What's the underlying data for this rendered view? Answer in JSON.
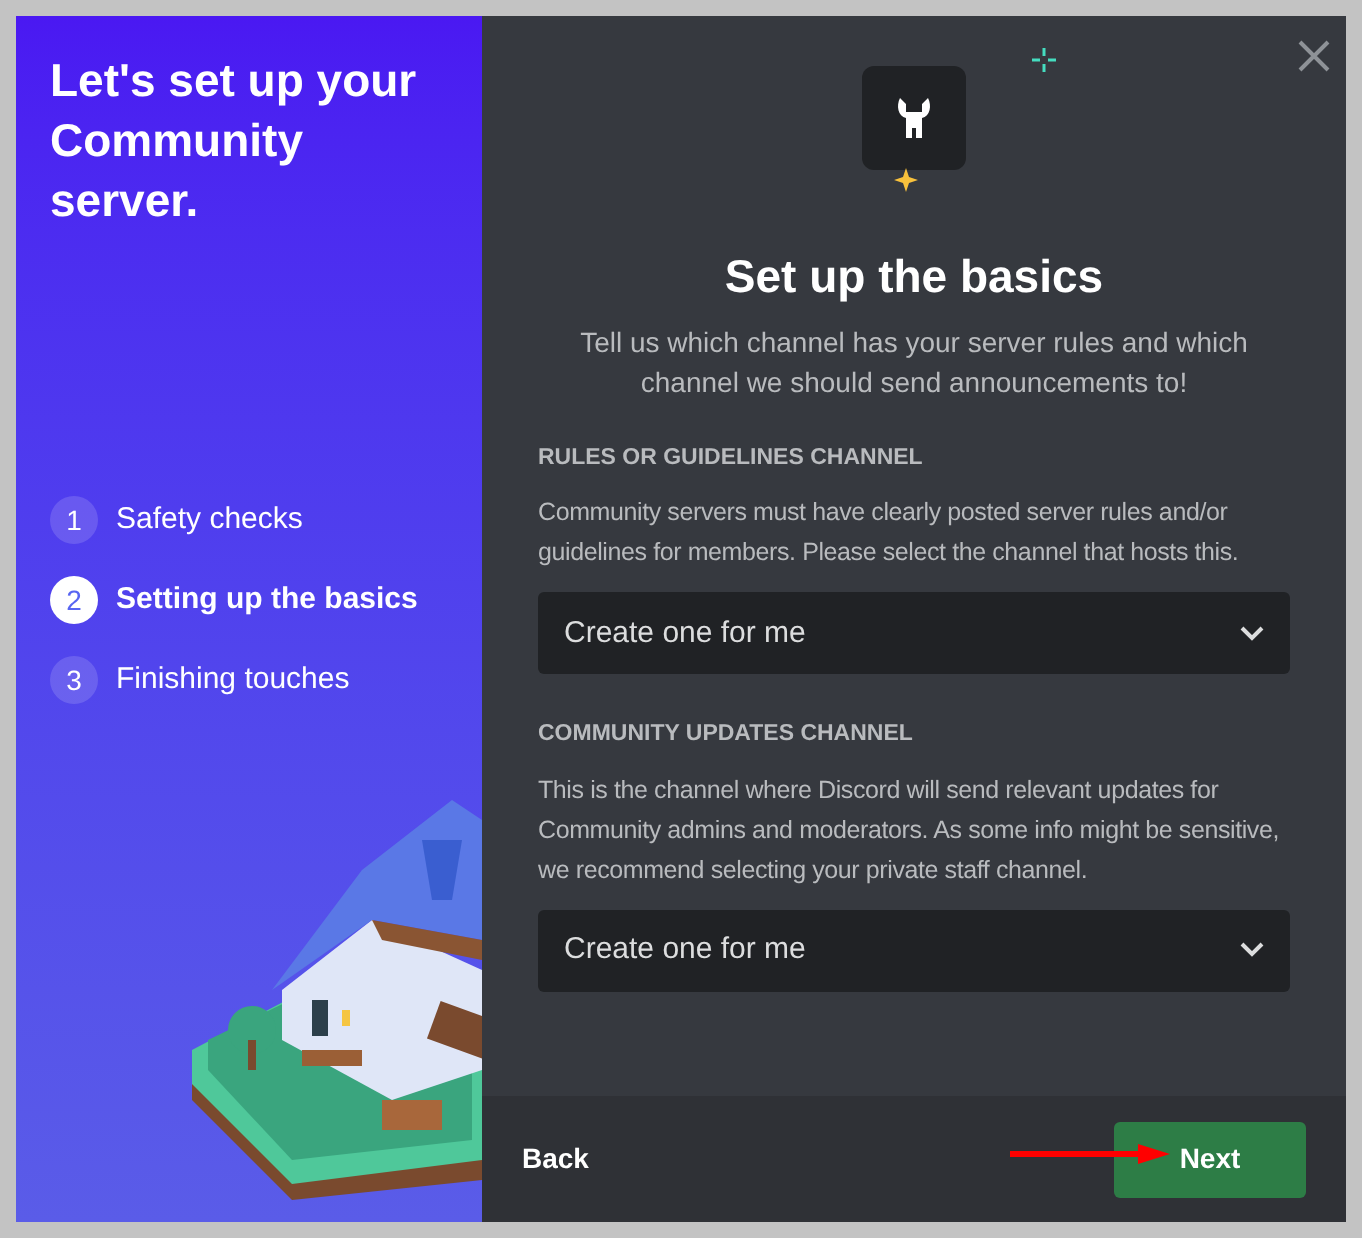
{
  "sidebar": {
    "title": "Let's set up your Community server.",
    "steps": [
      {
        "number": "1",
        "label": "Safety checks",
        "selected": false
      },
      {
        "number": "2",
        "label": "Setting up the basics",
        "selected": true
      },
      {
        "number": "3",
        "label": "Finishing touches",
        "selected": false
      }
    ]
  },
  "main": {
    "title": "Set up the basics",
    "subtitle": "Tell us which channel has your server rules and which channel we should send announcements to!",
    "sections": [
      {
        "heading": "RULES OR GUIDELINES CHANNEL",
        "description": "Community servers must have clearly posted server rules and/or guidelines for members. Please select the channel that hosts this.",
        "value": "Create one for me"
      },
      {
        "heading": "COMMUNITY UPDATES CHANNEL",
        "description": "This is the channel where Discord will send relevant updates for Community admins and moderators. As some info might be sensitive, we recommend selecting your private staff channel.",
        "value": "Create one for me"
      }
    ]
  },
  "footer": {
    "back": "Back",
    "next": "Next"
  }
}
